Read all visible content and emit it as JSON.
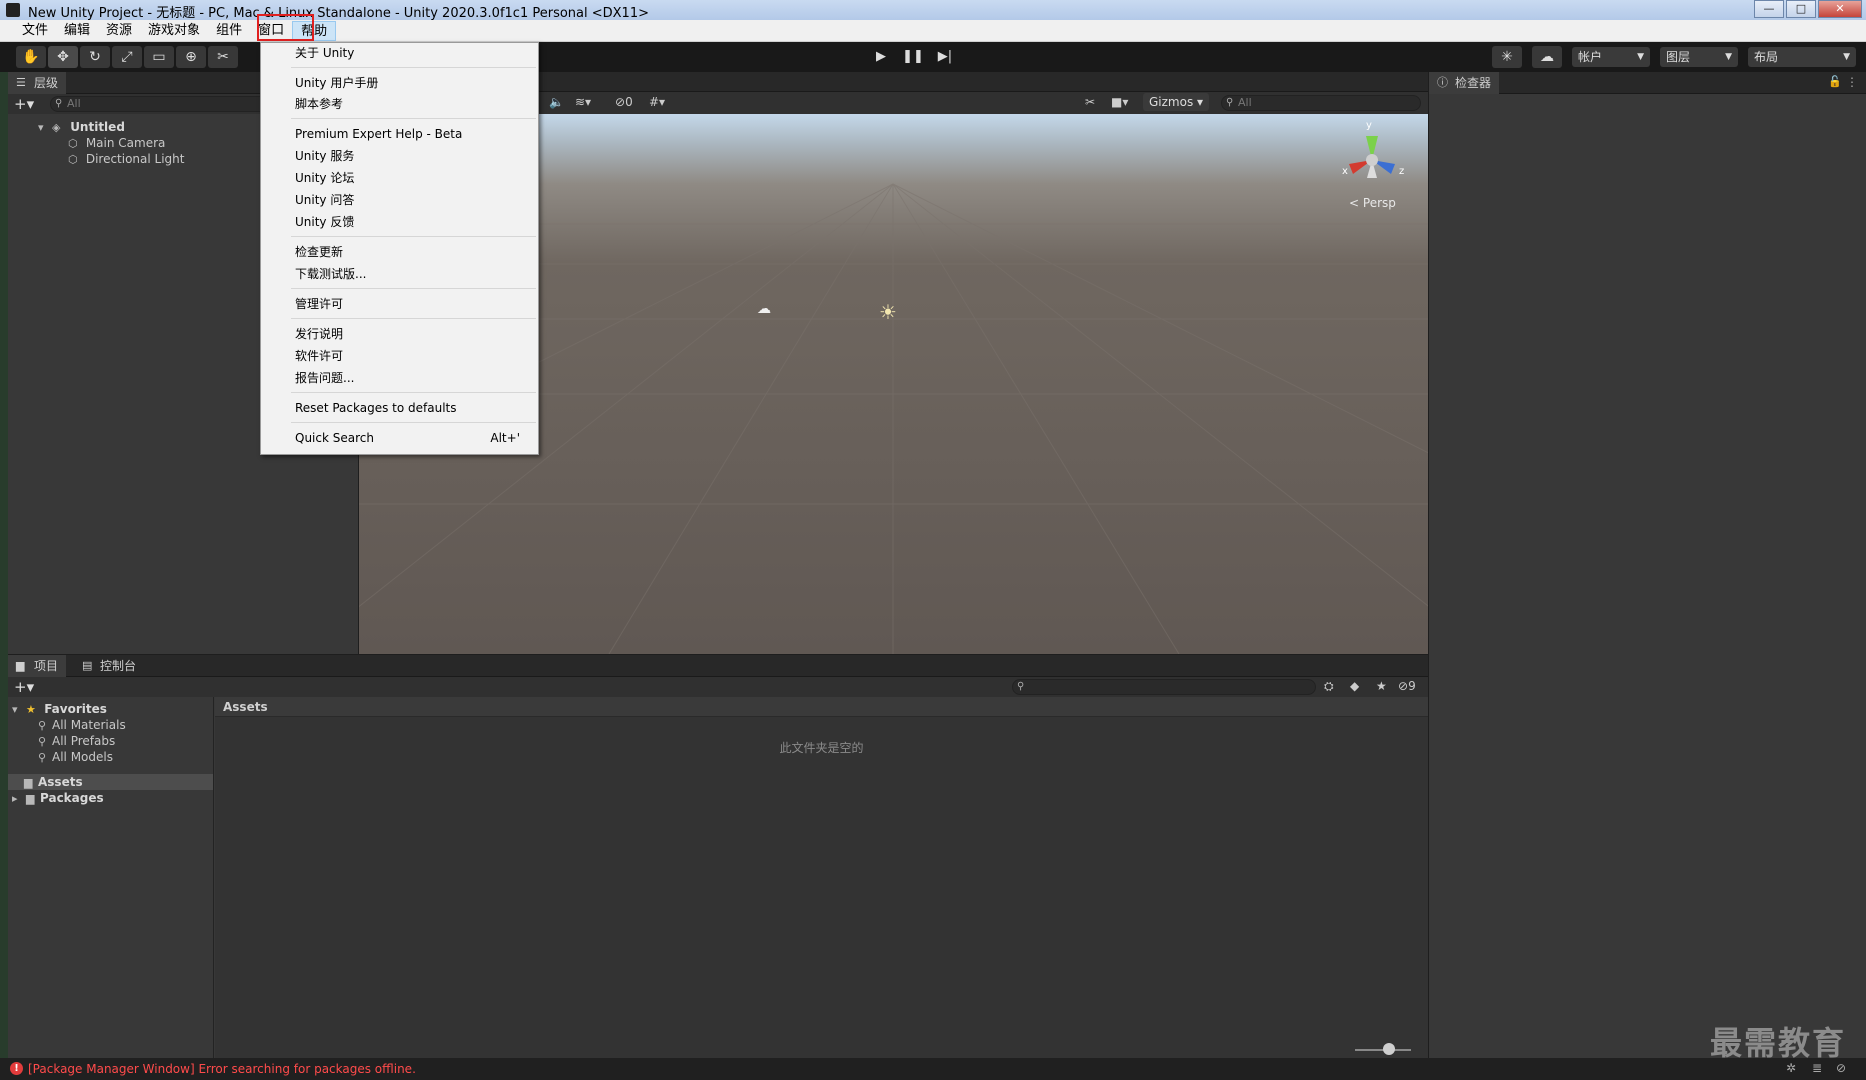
{
  "window": {
    "title": "New Unity Project - 无标题 - PC, Mac & Linux Standalone - Unity 2020.3.0f1c1 Personal <DX11>",
    "minimize": "—",
    "maximize": "□",
    "close": "✕"
  },
  "menubar": {
    "items": [
      "文件",
      "编辑",
      "资源",
      "游戏对象",
      "组件",
      "窗口",
      "帮助"
    ]
  },
  "help_menu": {
    "items": [
      "关于 Unity",
      "Unity 用户手册",
      "脚本参考",
      "Premium Expert Help - Beta",
      "Unity 服务",
      "Unity 论坛",
      "Unity 问答",
      "Unity 反馈",
      "检查更新",
      "下载测试版...",
      "管理许可",
      "发行说明",
      "软件许可",
      "报告问题...",
      "Reset Packages to defaults",
      "Quick Search"
    ],
    "quick_search_shortcut": "Alt+'"
  },
  "toolbar": {
    "account_label": "帐户",
    "layers_label": "图层",
    "layout_label": "布局"
  },
  "hierarchy": {
    "tab_label": "层级",
    "search_placeholder": "All",
    "scene_name": "Untitled",
    "objects": [
      "Main Camera",
      "Directional Light"
    ]
  },
  "scene": {
    "hidden_count": "0",
    "gizmos_label": "Gizmos",
    "search_placeholder": "All",
    "persp_label": "Persp",
    "axis_y": "y",
    "axis_x": "x",
    "axis_z": "z"
  },
  "inspector": {
    "tab_label": "检查器"
  },
  "project": {
    "tabs": [
      "项目",
      "控制台"
    ],
    "favorites_label": "Favorites",
    "favorites": [
      "All Materials",
      "All Prefabs",
      "All Models"
    ],
    "folders": [
      "Assets",
      "Packages"
    ],
    "assets_header": "Assets",
    "empty_message": "此文件夹是空的",
    "hidden_count": "9"
  },
  "status": {
    "error_message": "[Package Manager Window] Error searching for packages offline."
  },
  "watermark": "最需教育",
  "colors": {
    "highlight_box": "#e02020",
    "error_text": "#ff4b4b"
  }
}
